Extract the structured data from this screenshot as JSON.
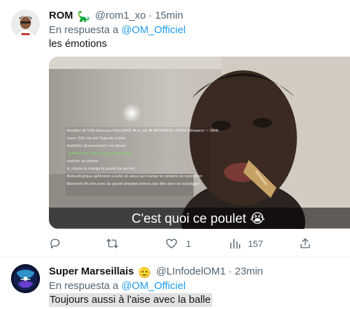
{
  "tweets": [
    {
      "display_name": "ROM",
      "name_emoji": "🦕",
      "handle": "@rom1_xo",
      "separator": "·",
      "time": "15min",
      "reply_prefix": "En respuesta a",
      "reply_to": "@OM_Officiel",
      "text": "les émotions",
      "media": {
        "caption": "C'est quoi ce poulet 😭",
        "chat_lines": [
          "WizeBot ACTION Nouveau FOLLOWER ♥ el_ash ♥ BIENVENUE (38056 followers) ~ (999)",
          "maun_651 rox est l'égende mister",
          "the00m2 @mornmor03 mé delete",
          "_JUNeeTrash_DAS plaquo canalisation",
          "realfrzy up lafiuve",
          "al_rokyte tu mange le poulet de secrtet",
          "BebouAlypique @Amwod a juste un aieux qui mange le conbeno en quonditon",
          "Bleavorfo fin non avec du poulet dreeeee kaessa dos fâte dans les barbiggen"
        ]
      },
      "actions": {
        "reply_count": "",
        "retweet_count": "",
        "like_count": "1",
        "views_count": "157"
      }
    },
    {
      "display_name": "Super Marseillais",
      "name_emoji": "🫡",
      "handle": "@LInfodelOM1",
      "separator": "·",
      "time": "23min",
      "reply_prefix": "En respuesta a",
      "reply_to": "@OM_Officiel",
      "text": "Toujours aussi à l'aise avec la balle"
    }
  ],
  "icons": {
    "reply": "reply-icon",
    "retweet": "retweet-icon",
    "like": "heart-icon",
    "views": "views-icon",
    "share": "share-icon"
  },
  "colors": {
    "link": "#1d9bf0",
    "secondary_text": "#536471",
    "primary_text": "#0f1419"
  }
}
